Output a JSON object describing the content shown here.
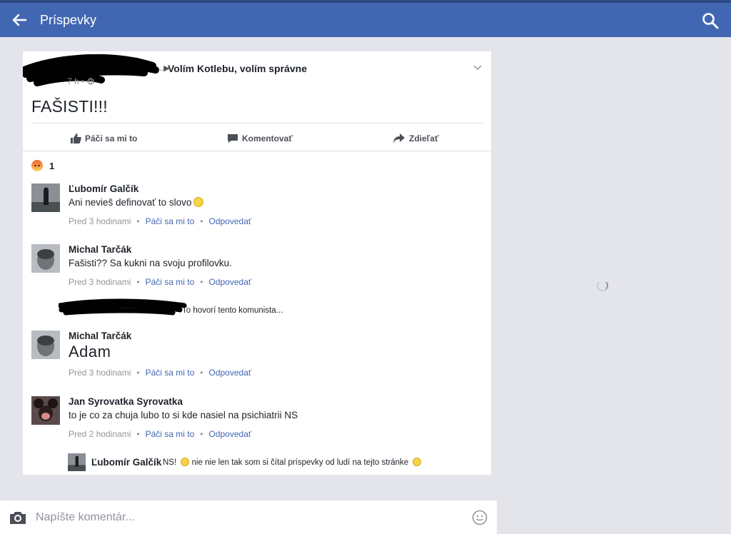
{
  "topbar": {
    "title": "Príspevky",
    "back_icon": "arrow-left-icon",
    "search_icon": "search-icon",
    "bg_color": "#4267b2"
  },
  "post": {
    "author_redacted": true,
    "author_suffix": "...",
    "target_page": "Volím Kotlebu, volím správne",
    "time": "7 h",
    "text": "FAŠISTI!!!",
    "actions": {
      "like": "Páči sa mi to",
      "comment": "Komentovať",
      "share": "Zdieľať"
    },
    "reaction_count": "1"
  },
  "comments": [
    {
      "name": "Ľubomír Galčík",
      "text": "Ani nevieš definovať to slovo",
      "time": "Pred 3 hodinami",
      "like": "Páči sa mi to",
      "reply": "Odpovedať"
    },
    {
      "name": "Michal Tarčák",
      "text": "Fašisti??  Sa kukni na svoju profilovku.",
      "time": "Pred 3 hodinami",
      "like": "Páči sa mi to",
      "reply": "Odpovedať"
    },
    {
      "name": "Michal Tarčák",
      "text": "Adam",
      "time": "Pred 3 hodinami",
      "like": "Páči sa mi to",
      "reply": "Odpovedať"
    },
    {
      "name": "Jan Syrovatka Syrovatka",
      "text": "to je co za chuja lubo to si kde nasiel na psichiatrii NS",
      "time": "Pred 2 hodinami",
      "like": "Páči sa mi to",
      "reply": "Odpovedať"
    }
  ],
  "mention_line": "To hovorí tento komunista...",
  "reply": {
    "name": "Ľubomír Galčík",
    "text_a": "NS!",
    "text_b": "nie nie len tak som si čítal príspevky od ludí na tejto stránke"
  },
  "composer": {
    "placeholder": "Napíšte komentár...",
    "camera_icon": "camera-icon",
    "emoji_icon": "smiley-icon"
  }
}
